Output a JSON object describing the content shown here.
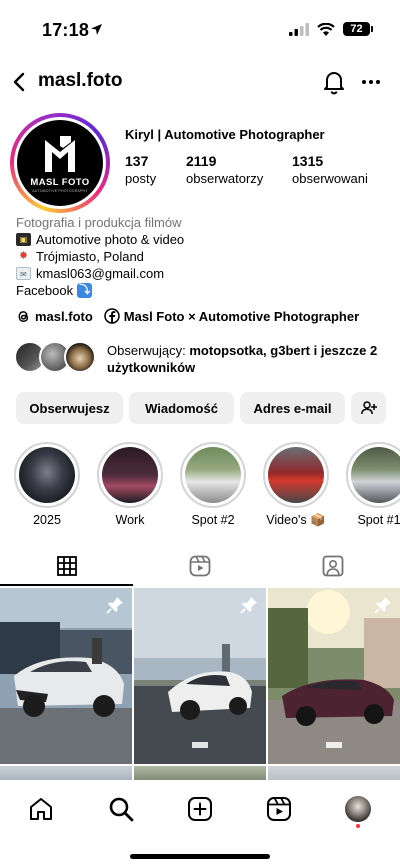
{
  "status_bar": {
    "time": "17:18",
    "battery": "72"
  },
  "header": {
    "username": "masl.foto"
  },
  "profile": {
    "logo_name": "MASL FOTO",
    "logo_tagline": "AUTOMOTIVE PHOTOGRAPHY",
    "display_name": "Kiryl | Automotive Photographer",
    "stats": [
      {
        "value": "137",
        "label": "posty"
      },
      {
        "value": "2119",
        "label": "obserwatorzy"
      },
      {
        "value": "1315",
        "label": "obserwowani"
      }
    ],
    "bio": {
      "category": "Fotografia i produkcja filmów",
      "lines": [
        "Automotive photo & video",
        "Trójmiasto, Poland",
        "kmasl063@gmail.com"
      ],
      "facebook": "Facebook"
    },
    "links": {
      "threads": "masl.foto",
      "facebook_page": "Masl Foto × Automotive Photographer"
    },
    "followed_by": {
      "prefix": "Obserwujący: ",
      "names": "motopsotka, g3bert",
      "suffix": " i jeszcze 2 użytkowników"
    }
  },
  "buttons": {
    "follow": "Obserwujesz",
    "message": "Wiadomość",
    "email": "Adres e-mail"
  },
  "highlights": [
    {
      "label": "2025"
    },
    {
      "label": "Work"
    },
    {
      "label": "Spot #2"
    },
    {
      "label": "Video's 📦"
    },
    {
      "label": "Spot #1"
    }
  ],
  "colors": {
    "accent_story": "#ee2a7b",
    "button_bg": "#efefef",
    "notification": "#ff3040"
  }
}
